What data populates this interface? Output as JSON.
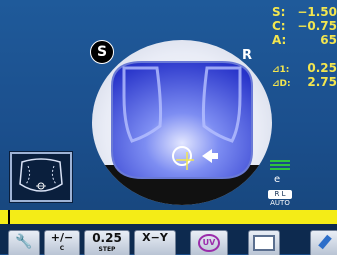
{
  "readout": {
    "s_label": "S:",
    "s_value": "−1.50",
    "c_label": "C:",
    "c_value": "−0.75",
    "a_label": "A:",
    "a_value": "65",
    "p1_label": "⊿1:",
    "p1_value": "0.25",
    "pd_label": "⊿D:",
    "pd_value": "2.75",
    "text_color": "#f3e64f"
  },
  "lens": {
    "side_badge": "S",
    "eye_label": "R"
  },
  "right_icons": {
    "e_label": "e",
    "auto_top": "R L",
    "auto_bottom": "AUTO"
  },
  "toolbar": {
    "wrench_icon": "wrench-icon",
    "plusminus_label": "+/−",
    "plusminus_sub": "C",
    "step_label": "0.25",
    "step_sub": "STEP",
    "xy_label": "X−Y",
    "uv_label": "UV",
    "print_icon": "printer-icon",
    "pen_icon": "marker-icon"
  },
  "colors": {
    "background": "#1b4f8d",
    "accent_yellow": "#f4ec17",
    "lens_blue": "#2a3fd0",
    "cursor": "#f3e64f"
  }
}
